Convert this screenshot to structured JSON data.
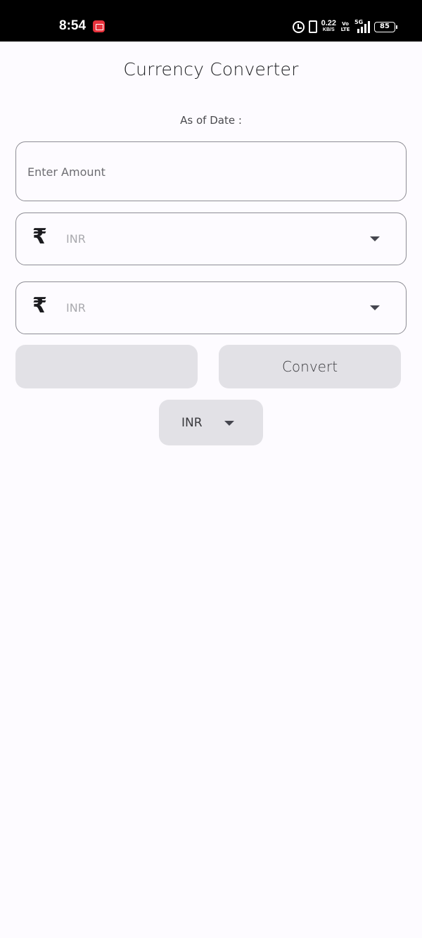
{
  "status_bar": {
    "time": "8:54",
    "net_speed": "0.22",
    "net_speed_unit": "KB/S",
    "volte": "Vo LTE",
    "network_type": "5G",
    "battery": "85",
    "icons": [
      "screen-record-icon",
      "alarm-icon",
      "vibrate-icon",
      "signal-icon",
      "battery-icon"
    ]
  },
  "header": {
    "title": "Currency Converter"
  },
  "date_label": "As of Date :",
  "amount_field": {
    "placeholder": "Enter Amount",
    "value": ""
  },
  "from_currency": {
    "symbol": "₹",
    "value": "INR",
    "icon": "chevron-down-icon"
  },
  "to_currency": {
    "symbol": "₹",
    "value": "INR",
    "icon": "chevron-down-icon"
  },
  "result": {
    "value": ""
  },
  "convert_button": {
    "label": "Convert"
  },
  "base_currency_dropdown": {
    "value": "INR"
  },
  "colors": {
    "background": "#fdfbff",
    "button_fill": "#e2e1e6",
    "field_border": "#8d8d94",
    "status_bar": "#000000",
    "record_badge": "#e8323c"
  }
}
